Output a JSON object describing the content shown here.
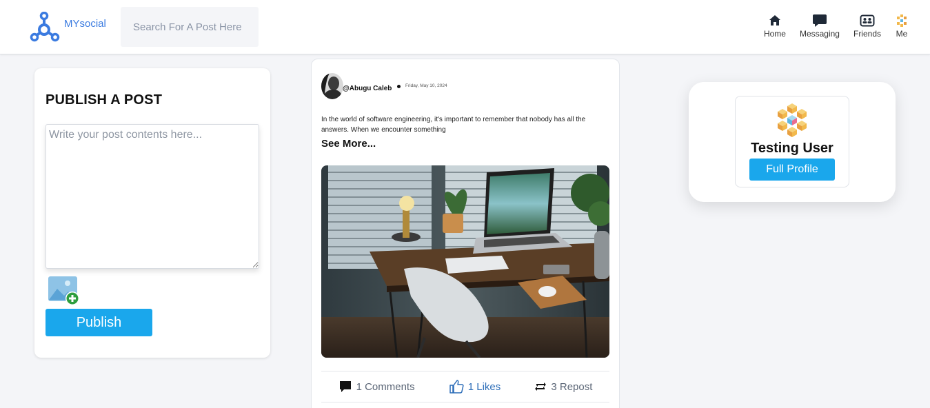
{
  "header": {
    "logo_text": "MYsocial",
    "search_placeholder": "Search For A Post Here",
    "nav": [
      {
        "label": "Home",
        "icon": "home-icon"
      },
      {
        "label": "Messaging",
        "icon": "message-icon"
      },
      {
        "label": "Friends",
        "icon": "contacts-icon"
      },
      {
        "label": "Me",
        "icon": "avatar-icon"
      }
    ]
  },
  "publish": {
    "title": "PUBLISH A POST",
    "textarea_placeholder": "Write your post contents here...",
    "button_label": "Publish"
  },
  "post": {
    "username": "@Abugu Caleb",
    "date": "Friday, May 10, 2024",
    "body": "In the world of software engineering, it's important to remember that nobody has all the answers. When we encounter something",
    "see_more": "See More...",
    "comments": "1 Comments",
    "likes": "1 Likes",
    "reposts": "3 Repost"
  },
  "profile": {
    "name": "Testing User",
    "button_label": "Full Profile"
  },
  "colors": {
    "accent": "#1aa7ec",
    "logo": "#3b7be0",
    "background": "#f4f5f8"
  }
}
